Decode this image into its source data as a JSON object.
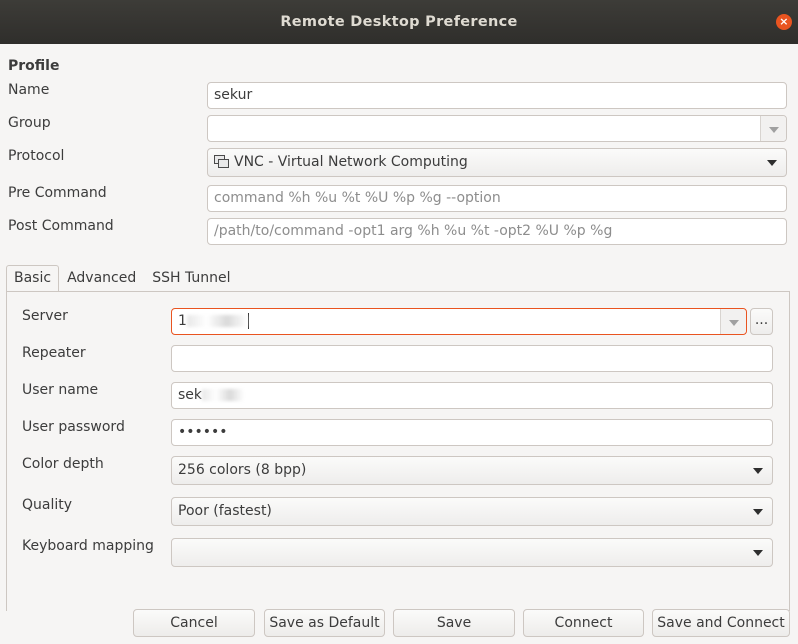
{
  "window": {
    "title": "Remote Desktop Preference",
    "close_glyph": "×"
  },
  "profile": {
    "section_title": "Profile",
    "labels": {
      "name": "Name",
      "group": "Group",
      "protocol": "Protocol",
      "pre_command": "Pre Command",
      "post_command": "Post Command"
    },
    "name_value": "sekur",
    "group_value": "",
    "protocol_value": "VNC - Virtual Network Computing",
    "protocol_icon": "vnc-icon",
    "pre_command_placeholder": "command %h %u %t %U %p %g --option",
    "post_command_placeholder": "/path/to/command -opt1 arg %h %u %t -opt2 %U %p %g"
  },
  "tabs": [
    "Basic",
    "Advanced",
    "SSH Tunnel"
  ],
  "basic": {
    "labels": {
      "server": "Server",
      "repeater": "Repeater",
      "user_name": "User name",
      "user_password": "User password",
      "color_depth": "Color depth",
      "quality": "Quality",
      "keyboard_mapping": "Keyboard mapping"
    },
    "server_value_visible": "1",
    "server_browse_label": "...",
    "repeater_value": "",
    "user_name_visible": "sek",
    "user_password_mask": "••••••",
    "color_depth_value": "256 colors (8 bpp)",
    "quality_value": "Poor (fastest)",
    "keyboard_mapping_value": ""
  },
  "buttons": {
    "cancel": "Cancel",
    "save_as_default": "Save as Default",
    "save": "Save",
    "connect": "Connect",
    "save_and_connect": "Save and Connect"
  },
  "colors": {
    "accent": "#e95420",
    "titlebar": "#2f2e2b"
  }
}
